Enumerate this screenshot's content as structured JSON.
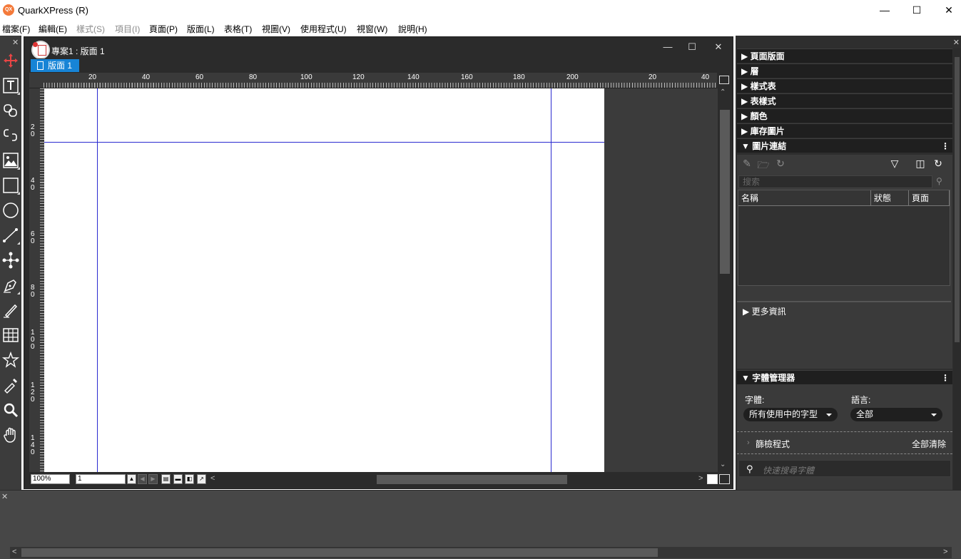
{
  "app": {
    "title": "QuarkXPress (R)",
    "icon_label": "QX",
    "accent_color": "#1784d6",
    "window_controls": [
      "minimize-icon",
      "maximize-icon",
      "close-icon"
    ]
  },
  "menubar": {
    "items": [
      {
        "label": "檔案(F)",
        "enabled": true
      },
      {
        "label": "編輯(E)",
        "enabled": true
      },
      {
        "label": "樣式(S)",
        "enabled": false
      },
      {
        "label": "項目(I)",
        "enabled": false
      },
      {
        "label": "頁面(P)",
        "enabled": true
      },
      {
        "label": "版面(L)",
        "enabled": true
      },
      {
        "label": "表格(T)",
        "enabled": true
      },
      {
        "label": "視圖(V)",
        "enabled": true
      },
      {
        "label": "使用程式(U)",
        "enabled": true
      },
      {
        "label": "視窗(W)",
        "enabled": true
      },
      {
        "label": "說明(H)",
        "enabled": true
      }
    ]
  },
  "toolbar": {
    "tools": [
      "move-tool-icon",
      "text-content-tool-icon",
      "text-linking-tool-icon",
      "text-unlinking-tool-icon",
      "picture-content-tool-icon",
      "rectangle-box-tool-icon",
      "oval-box-tool-icon",
      "line-tool-icon",
      "point-tool-icon",
      "pen-tool-icon",
      "freehand-tool-icon",
      "table-tool-icon",
      "starburst-tool-icon",
      "format-painter-tool-icon",
      "zoom-tool-icon",
      "pan-tool-icon"
    ]
  },
  "document": {
    "title": "專案1 : 版面 1",
    "tab_label": "版面 1",
    "ruler_top_labels": [
      "20",
      "40",
      "60",
      "80",
      "100",
      "120",
      "140",
      "160",
      "180",
      "200",
      "20",
      "40"
    ],
    "ruler_left_labels": [
      "2\n0",
      "4\n0",
      "6\n0",
      "8\n0",
      "1\n0\n0",
      "1\n2\n0",
      "1\n4\n0"
    ],
    "zoom": "100%",
    "page_number": "1"
  },
  "right_panel": {
    "sections": [
      "頁面版面",
      "層",
      "樣式表",
      "表樣式",
      "顏色",
      "庫存圖片",
      "圖片連結"
    ],
    "picture_links": {
      "search_placeholder": "搜索",
      "columns": [
        "名稱",
        "狀態",
        "頁面"
      ],
      "more_info": "更多資訊"
    },
    "font_manager": {
      "title": "字體管理器",
      "font_label": "字體:",
      "font_value": "所有使用中的字型",
      "language_label": "語言:",
      "language_value": "全部",
      "filters_label": "篩檢程式",
      "clear_all": "全部清除",
      "search_placeholder": "快速搜尋字體"
    }
  }
}
